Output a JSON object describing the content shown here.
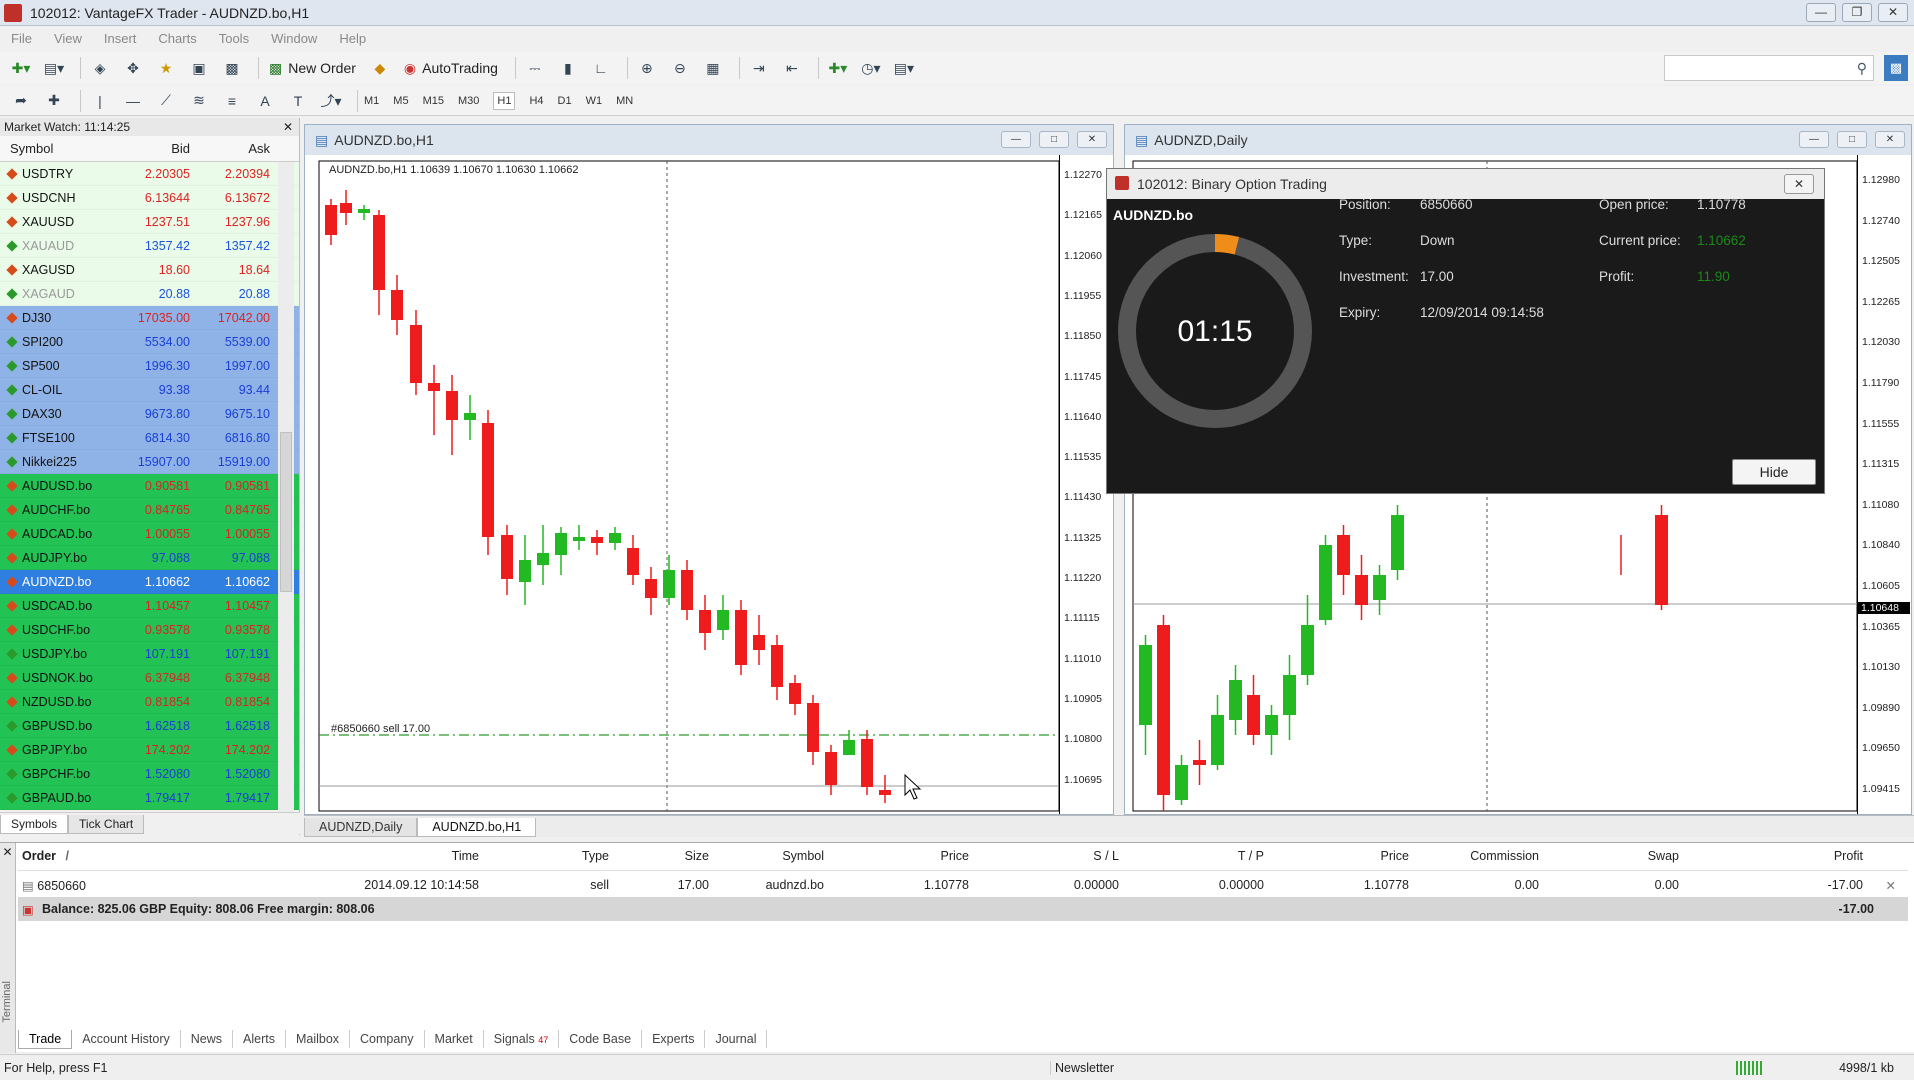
{
  "window": {
    "title": "102012: VantageFX Trader - AUDNZD.bo,H1"
  },
  "menu": [
    "File",
    "View",
    "Insert",
    "Charts",
    "Tools",
    "Window",
    "Help"
  ],
  "toolbar": {
    "new_order": "New Order",
    "autotrading": "AutoTrading"
  },
  "periods": [
    "M1",
    "M5",
    "M15",
    "M30",
    "H1",
    "H4",
    "D1",
    "W1",
    "MN"
  ],
  "active_period": "H1",
  "market_watch": {
    "title": "Market Watch: 11:14:25",
    "columns": {
      "symbol": "Symbol",
      "bid": "Bid",
      "ask": "Ask"
    },
    "rows": [
      {
        "symbol": "USDTRY",
        "bid": "2.20305",
        "ask": "2.20394",
        "bg": "#eafbea",
        "fg": "#d22",
        "icon": "#d84a1a"
      },
      {
        "symbol": "USDCNH",
        "bid": "6.13644",
        "ask": "6.13672",
        "bg": "#eafbea",
        "fg": "#d22",
        "icon": "#d84a1a"
      },
      {
        "symbol": "XAUUSD",
        "bid": "1237.51",
        "ask": "1237.96",
        "bg": "#eafbea",
        "fg": "#d22",
        "icon": "#d84a1a"
      },
      {
        "symbol": "XAUAUD",
        "bid": "1357.42",
        "ask": "1357.42",
        "bg": "#eafbea",
        "fg": "#1a55d6",
        "icon": "#2a9a2a",
        "dim": true
      },
      {
        "symbol": "XAGUSD",
        "bid": "18.60",
        "ask": "18.64",
        "bg": "#eafbea",
        "fg": "#d22",
        "icon": "#d84a1a"
      },
      {
        "symbol": "XAGAUD",
        "bid": "20.88",
        "ask": "20.88",
        "bg": "#eafbea",
        "fg": "#1a55d6",
        "icon": "#2a9a2a",
        "dim": true
      },
      {
        "symbol": "DJ30",
        "bid": "17035.00",
        "ask": "17042.00",
        "bg": "#8fb3e6",
        "fg": "#d22",
        "icon": "#d84a1a"
      },
      {
        "symbol": "SPI200",
        "bid": "5534.00",
        "ask": "5539.00",
        "bg": "#8fb3e6",
        "fg": "#1a3fd6",
        "icon": "#2a9a2a"
      },
      {
        "symbol": "SP500",
        "bid": "1996.30",
        "ask": "1997.00",
        "bg": "#8fb3e6",
        "fg": "#1a3fd6",
        "icon": "#2a9a2a"
      },
      {
        "symbol": "CL-OIL",
        "bid": "93.38",
        "ask": "93.44",
        "bg": "#8fb3e6",
        "fg": "#1a3fd6",
        "icon": "#2a9a2a"
      },
      {
        "symbol": "DAX30",
        "bid": "9673.80",
        "ask": "9675.10",
        "bg": "#8fb3e6",
        "fg": "#1a3fd6",
        "icon": "#2a9a2a"
      },
      {
        "symbol": "FTSE100",
        "bid": "6814.30",
        "ask": "6816.80",
        "bg": "#8fb3e6",
        "fg": "#1a3fd6",
        "icon": "#2a9a2a"
      },
      {
        "symbol": "Nikkei225",
        "bid": "15907.00",
        "ask": "15919.00",
        "bg": "#8fb3e6",
        "fg": "#1a3fd6",
        "icon": "#2a9a2a"
      },
      {
        "symbol": "AUDUSD.bo",
        "bid": "0.90581",
        "ask": "0.90581",
        "bg": "#22c254",
        "fg": "#d22",
        "icon": "#d84a1a"
      },
      {
        "symbol": "AUDCHF.bo",
        "bid": "0.84765",
        "ask": "0.84765",
        "bg": "#22c254",
        "fg": "#d22",
        "icon": "#d84a1a"
      },
      {
        "symbol": "AUDCAD.bo",
        "bid": "1.00055",
        "ask": "1.00055",
        "bg": "#22c254",
        "fg": "#d22",
        "icon": "#d84a1a"
      },
      {
        "symbol": "AUDJPY.bo",
        "bid": "97.088",
        "ask": "97.088",
        "bg": "#22c254",
        "fg": "#1a3fd6",
        "icon": "#d84a1a"
      },
      {
        "symbol": "AUDNZD.bo",
        "bid": "1.10662",
        "ask": "1.10662",
        "bg": "#2f7fe0",
        "fg": "#ffffff",
        "icon": "#d84a1a",
        "selected": true
      },
      {
        "symbol": "USDCAD.bo",
        "bid": "1.10457",
        "ask": "1.10457",
        "bg": "#22c254",
        "fg": "#d22",
        "icon": "#d84a1a"
      },
      {
        "symbol": "USDCHF.bo",
        "bid": "0.93578",
        "ask": "0.93578",
        "bg": "#22c254",
        "fg": "#d22",
        "icon": "#d84a1a"
      },
      {
        "symbol": "USDJPY.bo",
        "bid": "107.191",
        "ask": "107.191",
        "bg": "#22c254",
        "fg": "#1a3fd6",
        "icon": "#2a9a2a"
      },
      {
        "symbol": "USDNOK.bo",
        "bid": "6.37948",
        "ask": "6.37948",
        "bg": "#22c254",
        "fg": "#d22",
        "icon": "#d84a1a"
      },
      {
        "symbol": "NZDUSD.bo",
        "bid": "0.81854",
        "ask": "0.81854",
        "bg": "#22c254",
        "fg": "#d22",
        "icon": "#d84a1a"
      },
      {
        "symbol": "GBPUSD.bo",
        "bid": "1.62518",
        "ask": "1.62518",
        "bg": "#22c254",
        "fg": "#1a3fd6",
        "icon": "#2a9a2a"
      },
      {
        "symbol": "GBPJPY.bo",
        "bid": "174.202",
        "ask": "174.202",
        "bg": "#22c254",
        "fg": "#d22",
        "icon": "#d84a1a"
      },
      {
        "symbol": "GBPCHF.bo",
        "bid": "1.52080",
        "ask": "1.52080",
        "bg": "#22c254",
        "fg": "#1a3fd6",
        "icon": "#2a9a2a"
      },
      {
        "symbol": "GBPAUD.bo",
        "bid": "1.79417",
        "ask": "1.79417",
        "bg": "#22c254",
        "fg": "#1a3fd6",
        "icon": "#2a9a2a"
      }
    ],
    "tabs": [
      "Symbols",
      "Tick Chart"
    ]
  },
  "chart_h1": {
    "title": "AUDNZD.bo,H1",
    "info": "AUDNZD.bo,H1  1.10639 1.10670 1.10630 1.10662",
    "order_label": "#6850660 sell 17.00",
    "current_price": "1.10662",
    "price_labels": [
      "1.12270",
      "1.12165",
      "1.12060",
      "1.11955",
      "1.11850",
      "1.11745",
      "1.11640",
      "1.11535",
      "1.11430",
      "1.11325",
      "1.11220",
      "1.11115",
      "1.11010",
      "1.10905",
      "1.10800",
      "1.10695"
    ]
  },
  "chart_daily": {
    "title": "AUDNZD,Daily",
    "current_price": "1.10648",
    "price_labels": [
      "1.12980",
      "1.12740",
      "1.12505",
      "1.12265",
      "1.12030",
      "1.11790",
      "1.11555",
      "1.11315",
      "1.11080",
      "1.10840",
      "1.10605",
      "1.10365",
      "1.10130",
      "1.09890",
      "1.09650",
      "1.09415"
    ]
  },
  "chart_tabs": [
    "AUDNZD,Daily",
    "AUDNZD.bo,H1"
  ],
  "active_chart_tab": "AUDNZD.bo,H1",
  "binary_option": {
    "title": "102012: Binary Option Trading",
    "symbol": "AUDNZD.bo",
    "timer": "01:15",
    "timer_progress": 0.04,
    "position_label": "Position:",
    "position": "6850660",
    "type_label": "Type:",
    "type": "Down",
    "investment_label": "Investment:",
    "investment": "17.00",
    "expiry_label": "Expiry:",
    "expiry": "12/09/2014 09:14:58",
    "open_price_label": "Open price:",
    "open_price": "1.10778",
    "current_price_label": "Current price:",
    "current_price": "1.10662",
    "profit_label": "Profit:",
    "profit": "11.90",
    "hide_label": "Hide"
  },
  "terminal": {
    "side_label": "Terminal",
    "columns": [
      "Order",
      "Time",
      "Type",
      "Size",
      "Symbol",
      "Price",
      "S / L",
      "T / P",
      "Price",
      "Commission",
      "Swap",
      "Profit"
    ],
    "order_sort_mark": "/",
    "row": {
      "order": "6850660",
      "time": "2014.09.12 10:14:58",
      "type": "sell",
      "size": "17.00",
      "symbol": "audnzd.bo",
      "price": "1.10778",
      "sl": "0.00000",
      "tp": "0.00000",
      "cur_price": "1.10778",
      "commission": "0.00",
      "swap": "0.00",
      "profit": "-17.00"
    },
    "balance_line": "Balance: 825.06 GBP  Equity: 808.06  Free margin: 808.06",
    "balance_profit": "-17.00",
    "tabs": [
      "Trade",
      "Account History",
      "News",
      "Alerts",
      "Mailbox",
      "Company",
      "Market",
      "Signals",
      "Code Base",
      "Experts",
      "Journal"
    ],
    "signals_badge": "47"
  },
  "status": {
    "help": "For Help, press F1",
    "newsletter": "Newsletter",
    "traffic": "4998/1 kb"
  }
}
